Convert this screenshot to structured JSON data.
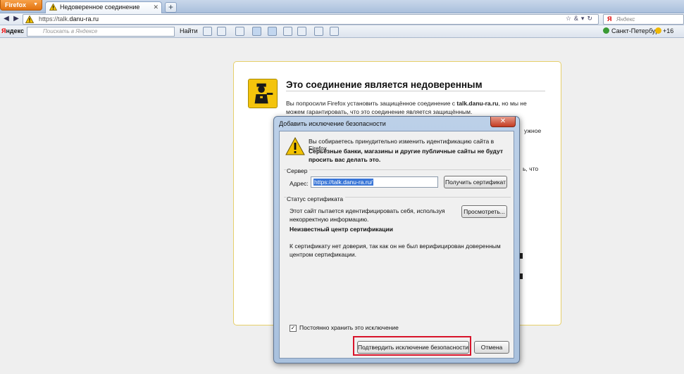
{
  "browser": {
    "menu_button": "Firefox",
    "tab_title": "Недоверенное соединение",
    "new_tab": "+",
    "url_prefix": "https://talk.",
    "url_host": "danu-ra.ru",
    "search_placeholder": "Яндекс"
  },
  "yandex_bar": {
    "logo_ya": "Я",
    "logo_rest": "ндекс",
    "search_placeholder": "Поискать в Яндексе",
    "find_label": "Найти",
    "city": "Санкт-Петербург",
    "temperature": "+16"
  },
  "error_page": {
    "title": "Это соединение является недоверенным",
    "text_before": "Вы попросили Firefox установить защищённое соединение с ",
    "host": "talk.danu-ra.ru",
    "text_after": ", но мы не можем гарантировать, что это соединение является защищённым.",
    "fragment_1": "ужное",
    "fragment_2": "ь, что"
  },
  "dialog": {
    "title": "Добавить исключение безопасности",
    "close": "✕",
    "message": "Вы собираетесь принудительно изменить идентификацию сайта в Firefox.",
    "warning": "Серьёзные банки, магазины и другие публичные сайты не будут просить вас делать это.",
    "server_group": "Сервер",
    "address_label": "Адрес:",
    "address_value": "https://talk.danu-ra.ru/",
    "get_cert_button": "Получить сертификат",
    "cert_status_group": "Статус сертификата",
    "status_text": "Этот сайт пытается идентифицировать себя, используя некорректную информацию.",
    "view_button": "Просмотреть...",
    "unknown_ca": "Неизвестный центр сертификации",
    "unknown_ca_desc": "К сертификату нет доверия, так как он не был верифицирован доверенным центром сертификации.",
    "permanent_label": "Постоянно хранить это исключение",
    "permanent_checked": "✓",
    "confirm_button": "Подтвердить исключение безопасности",
    "cancel_button": "Отмена"
  }
}
